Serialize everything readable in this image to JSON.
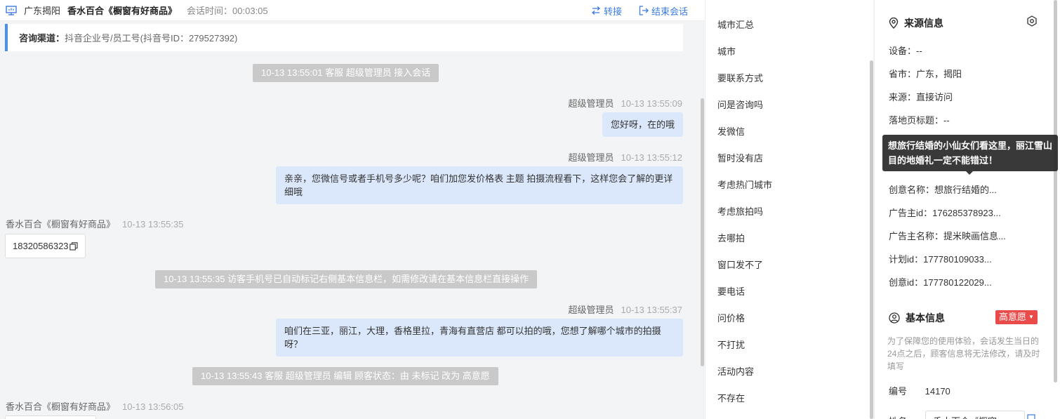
{
  "chat_header": {
    "location": "广东揭阳",
    "shop": "香水百合《橱窗有好商品》",
    "duration": "会话时间：00:03:05",
    "transfer": "转接",
    "end": "结束会话"
  },
  "channel": {
    "label": "咨询渠道：",
    "value": "抖音企业号/员工号(抖音号ID：279527392)"
  },
  "messages": {
    "sys1": "10-13 13:55:01 客服 超级管理员 接入会话",
    "a1_sender": "超级管理员",
    "a1_time": "10-13 13:55:09",
    "a1_text": "您好呀，在的哦",
    "a2_sender": "超级管理员",
    "a2_time": "10-13 13:55:12",
    "a2_text": "亲亲，您微信号或者手机号多少呢？咱们加您发价格表 主题 拍摄流程看下，这样您会了解的更详细哦",
    "v1_sender": "香水百合《橱窗有好商品》",
    "v1_time": "10-13 13:55:35",
    "v1_text": "18320586323",
    "sys2": "10-13 13:55:35 访客手机号已自动标记右侧基本信息栏，如需修改请在基本信息栏直接操作",
    "a3_sender": "超级管理员",
    "a3_time": "10-13 13:55:37",
    "a3_text": "咱们在三亚，丽江，大理，香格里拉，青海有直营店 都可以拍的哦，您想了解哪个城市的拍摄呀？",
    "sys3": "10-13 13:55:43 客服 超级管理员 编辑 顾客状态：由 未标记 改为 高意愿",
    "v2_sender": "香水百合《橱窗有好商品》",
    "v2_time": "10-13 13:56:05"
  },
  "quick_replies": [
    "城市汇总",
    "城市",
    "要联系方式",
    "问是咨询吗",
    "发微信",
    "暂时没有店",
    "考虑热门城市",
    "考虑旅拍吗",
    "去哪拍",
    "窗口发不了",
    "要电话",
    "问价格",
    "不打扰",
    "活动内容",
    "不存在"
  ],
  "source": {
    "title": "来源信息",
    "device": "设备：--",
    "region": "省市：广东，揭阳",
    "origin": "来源：直接访问",
    "landing": "落地页标题：--",
    "tooltip": "想旅行结婚的小仙女们看这里，丽江雪山目的地婚礼一定不能错过！",
    "creative_name": "创意名称：想旅行结婚的...",
    "advertiser_id": "广告主id：176285378923...",
    "advertiser_name": "广告主名称：提米映画信息...",
    "plan_id": "计划id：177780109033...",
    "creative_id": "创意id：177780122029..."
  },
  "basic": {
    "title": "基本信息",
    "intent": "高意愿",
    "note": "为了保障您的使用体验，会话发生当日的24点之后，顾客信息将无法修改，请及时填写",
    "number_label": "编号",
    "number_value": "14170",
    "name_value": "香水百合《橱窗..."
  },
  "colors": {
    "accent": "#3a7be0",
    "agent_bubble": "#dbe8fc",
    "system_bg": "#c9c9c9",
    "intent_badge": "#e94a4a"
  }
}
